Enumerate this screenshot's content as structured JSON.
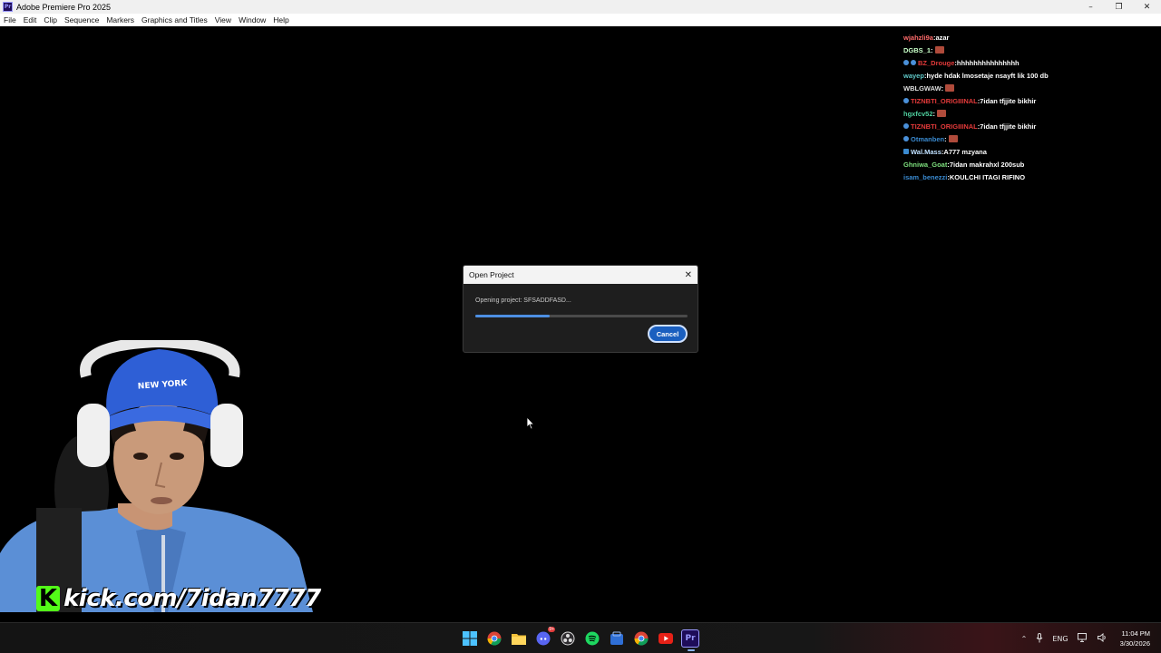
{
  "titlebar": {
    "title": "Adobe Premiere Pro 2025",
    "icon_text": "Pr"
  },
  "menu": [
    "File",
    "Edit",
    "Clip",
    "Sequence",
    "Markers",
    "Graphics and Titles",
    "View",
    "Window",
    "Help"
  ],
  "chat": [
    {
      "user": "wjahzli9a",
      "color": "#ff6b6b",
      "text": "azar",
      "emote": false,
      "badge": ""
    },
    {
      "user": "DGBS_1",
      "color": "#c8ffc8",
      "text": "",
      "emote": true,
      "badge": ""
    },
    {
      "user": "BZ_Drouge",
      "color": "#e43a3a",
      "text": "hhhhhhhhhhhhhhh",
      "emote": false,
      "badge": "double"
    },
    {
      "user": "wayep",
      "color": "#5fc8c8",
      "text": "hyde hdak lmosetaje nsayft lik 100 db",
      "emote": false,
      "badge": ""
    },
    {
      "user": "WBLGWAW",
      "color": "#dddddd",
      "text": "",
      "emote": true,
      "badge": ""
    },
    {
      "user": "TIZNBTI_ORIGIIINAL",
      "color": "#e43a3a",
      "text": "7idan tfjjite bikhir",
      "emote": false,
      "badge": "round"
    },
    {
      "user": "hgxfcv52",
      "color": "#4fd1a0",
      "text": "",
      "emote": true,
      "badge": ""
    },
    {
      "user": "TIZNBTI_ORIGIIINAL",
      "color": "#e43a3a",
      "text": "7idan tfjjite bikhir",
      "emote": false,
      "badge": "round"
    },
    {
      "user": "Otmanben",
      "color": "#3a8ad0",
      "text": "",
      "emote": true,
      "badge": "round"
    },
    {
      "user": "Wal.Mass",
      "color": "#bfe0ff",
      "text": "A777 mzyana",
      "emote": false,
      "badge": "square"
    },
    {
      "user": "Ghniwa_Goat",
      "color": "#7ee07e",
      "text": "7idan makrahxl 200sub",
      "emote": false,
      "badge": ""
    },
    {
      "user": "isam_benezzi",
      "color": "#3a8ad0",
      "text": "KOULCHI ITAGI RIFINO",
      "emote": false,
      "badge": ""
    }
  ],
  "dialog": {
    "title": "Open Project",
    "message": "Opening project: SFSADDFASD...",
    "progress_percent": 35,
    "cancel_label": "Cancel"
  },
  "watermark": {
    "logo": "K",
    "text": "kick.com/7idan7777"
  },
  "taskbar": {
    "apps": [
      "windows-start",
      "chrome",
      "file-explorer",
      "discord",
      "obs",
      "spotify",
      "app-store",
      "chrome-alt",
      "youtube",
      "premiere-pro"
    ],
    "discord_badge": "9+",
    "premiere_label": "Pr",
    "language": "ENG",
    "time": "11:04 PM",
    "date": "3/30/2026"
  }
}
